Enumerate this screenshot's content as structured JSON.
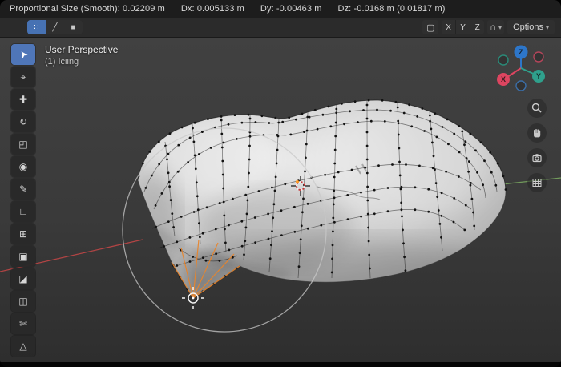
{
  "statusbar": {
    "segments": [
      "Proportional Size (Smooth): 0.02209 m",
      "Dx: 0.005133 m",
      "Dy: -0.00463 m",
      "Dz: -0.0168 m (0.01817 m)"
    ]
  },
  "header": {
    "select_modes": [
      {
        "name": "vertex",
        "glyph": "∷",
        "active": true
      },
      {
        "name": "edge",
        "glyph": "╱",
        "active": false
      },
      {
        "name": "face",
        "glyph": "■",
        "active": false
      }
    ],
    "right": {
      "mirror_icon_glyph": "▢",
      "axis_toggles": [
        "X",
        "Y",
        "Z"
      ],
      "snap_icon_glyph": "∩",
      "options_label": "Options",
      "chevron_glyph": "▾"
    }
  },
  "toolbar": {
    "tools": [
      {
        "id": "select-box",
        "glyph": "➤",
        "active": true
      },
      {
        "id": "cursor",
        "glyph": "⌖",
        "active": false
      },
      {
        "id": "move",
        "glyph": "✚",
        "active": false
      },
      {
        "id": "rotate",
        "glyph": "↻",
        "active": false
      },
      {
        "id": "scale",
        "glyph": "◰",
        "active": false
      },
      {
        "id": "transform",
        "glyph": "◉",
        "active": false
      },
      {
        "id": "annotate",
        "glyph": "✎",
        "active": false
      },
      {
        "id": "measure",
        "glyph": "∟",
        "active": false
      },
      {
        "id": "extrude-region",
        "glyph": "⊞",
        "active": false
      },
      {
        "id": "inset-faces",
        "glyph": "▣",
        "active": false
      },
      {
        "id": "bevel",
        "glyph": "◪",
        "active": false
      },
      {
        "id": "loop-cut",
        "glyph": "◫",
        "active": false
      },
      {
        "id": "knife",
        "glyph": "✄",
        "active": false
      },
      {
        "id": "poly-build",
        "glyph": "△",
        "active": false
      }
    ]
  },
  "viewport": {
    "view_label": "User Perspective",
    "object_label": "(1) Iciing",
    "gizmo_axes": [
      {
        "label": "Z",
        "color": "#2d76c9"
      },
      {
        "label": "X",
        "color": "#dd4560"
      },
      {
        "label": "Y",
        "color": "#2fa08c"
      }
    ],
    "colors": {
      "x_axis": "#c24646",
      "y_axis": "#6e9a5a",
      "proportional_circle": "#c8c8c8",
      "selection_orange": "#e8852c",
      "active_tool_blue": "#4f76b8",
      "mesh_light": "#e8e8e8",
      "mesh_dark": "#9a9a9a"
    }
  }
}
